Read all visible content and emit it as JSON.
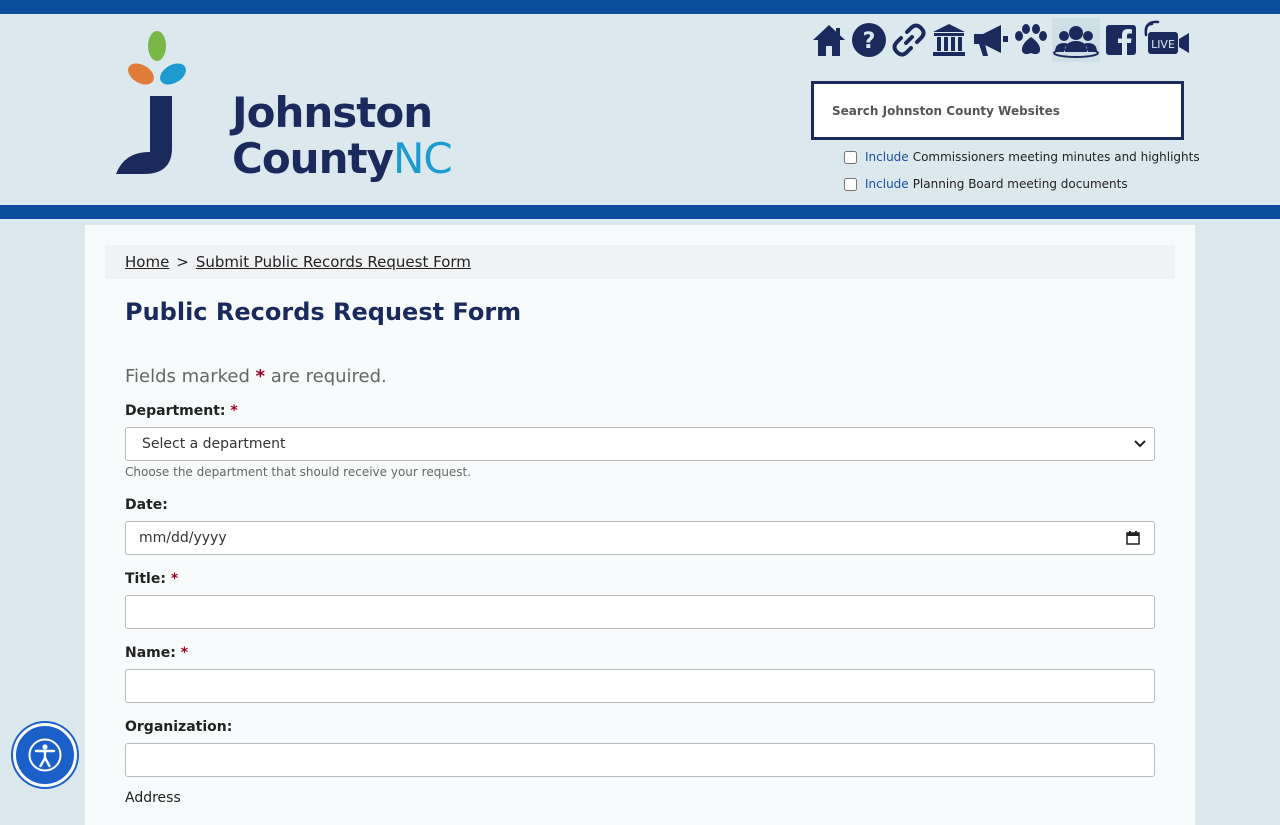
{
  "header": {
    "logo": {
      "line1": "Johnston",
      "line2_a": "County",
      "line2_b": "NC"
    },
    "icons": [
      "home-icon",
      "help-icon",
      "link-icon",
      "courthouse-icon",
      "megaphone-icon",
      "paw-icon",
      "group-icon",
      "facebook-icon",
      "live-video-icon"
    ],
    "icon_labels": {
      "live": "LIVE"
    },
    "search_placeholder": "Search Johnston County Websites",
    "checkboxes": [
      {
        "prefix": "Include",
        "label": "Commissioners meeting minutes and highlights",
        "checked": false
      },
      {
        "prefix": "Include",
        "label": "Planning Board meeting documents",
        "checked": false
      }
    ]
  },
  "breadcrumb": {
    "home": "Home",
    "sep": ">",
    "current": "Submit Public Records Request Form"
  },
  "form": {
    "title": "Public Records Request Form",
    "required_note_a": "Fields marked",
    "required_star": "*",
    "required_note_b": "are required.",
    "department": {
      "label": "Department:",
      "star": "*",
      "value": "Select a department",
      "help": "Choose the department that should receive your request."
    },
    "date": {
      "label": "Date:",
      "placeholder": "mm/dd/yyyy"
    },
    "title_field": {
      "label": "Title:",
      "star": "*"
    },
    "name_field": {
      "label": "Name:",
      "star": "*"
    },
    "org_field": {
      "label": "Organization:"
    },
    "address_field": {
      "label": "Address"
    }
  },
  "colors": {
    "brand_blue": "#0b4f9c",
    "navy": "#1b2a5c",
    "accent_cyan": "#1d9bd1",
    "required_red": "#a00020",
    "bg": "#dbe9ee"
  }
}
